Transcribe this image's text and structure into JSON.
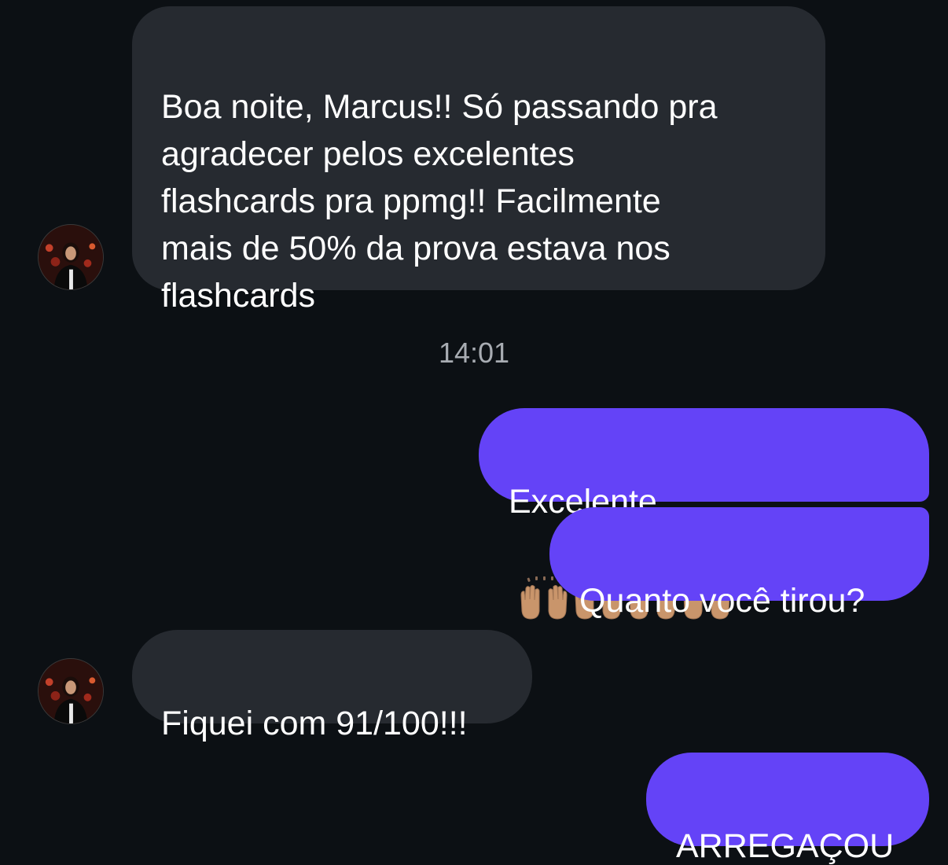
{
  "messages": [
    {
      "direction": "incoming",
      "text": "Boa noite, Marcus!! Só passando pra agradecer pelos excelentes flashcards pra ppmg!! Facilmente mais de 50% da prova estava nos flashcards",
      "lines": [
        "Boa noite, Marcus!! Só passando pra",
        "agradecer pelos excelentes",
        "flashcards pra ppmg!! Facilmente",
        "mais de 50% da prova estava nos",
        "flashcards"
      ]
    },
    {
      "direction": "timestamp",
      "text": "14:01"
    },
    {
      "direction": "outgoing",
      "text": "Excelente",
      "emoji": [
        "raising-hands-emoji",
        "raising-hands-emoji",
        "raising-hands-emoji",
        "raising-hands-emoji"
      ]
    },
    {
      "direction": "outgoing",
      "text": "Quanto você tirou?"
    },
    {
      "direction": "incoming",
      "text": "Fiquei com 91/100!!!"
    },
    {
      "direction": "outgoing",
      "text": "ARREGAÇOU"
    }
  ],
  "colors": {
    "background": "#0c1014",
    "incoming_bubble": "#262a30",
    "outgoing_bubble": "#6443f7",
    "text": "#ffffff",
    "timestamp": "#a8acb2"
  },
  "icons": {
    "avatar": "contact-avatar-photo",
    "emoji": "raising-hands-emoji"
  }
}
